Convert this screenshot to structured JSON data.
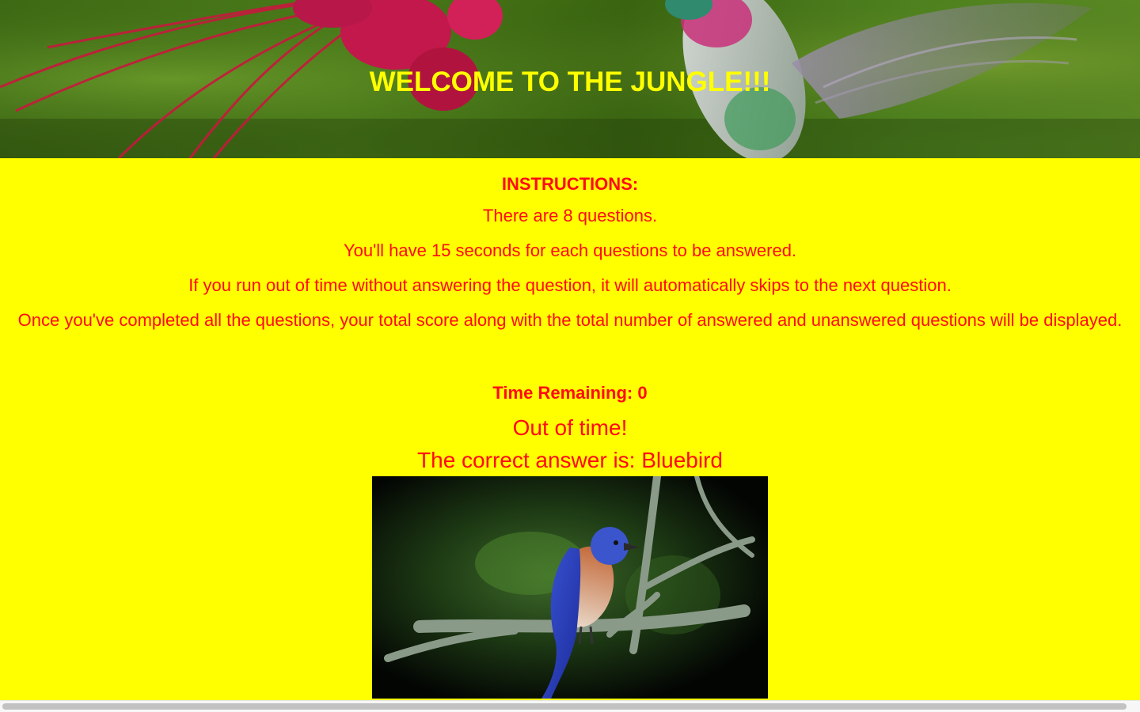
{
  "header": {
    "title": "WELCOME TO THE JUNGLE!!!",
    "background_image": "hummingbird-and-red-flower-photo"
  },
  "instructions": {
    "heading": "INSTRUCTIONS:",
    "rules": [
      "There are 8 questions.",
      "You'll have 15 seconds for each questions to be answered.",
      "If you run out of time without answering the question, it will automatically skips to the next question.",
      "Once you've completed all the questions, your total score along with the total number of answered and unanswered questions will be displayed."
    ]
  },
  "game": {
    "time_remaining": "Time Remaining: 0",
    "status": "Out of time!",
    "correct_answer": "The correct answer is: Bluebird",
    "answer_image": "bluebird-on-branch-photo"
  },
  "colors": {
    "page_background": "#ffff00",
    "text": "#ff0a14",
    "title": "#ffff00"
  }
}
